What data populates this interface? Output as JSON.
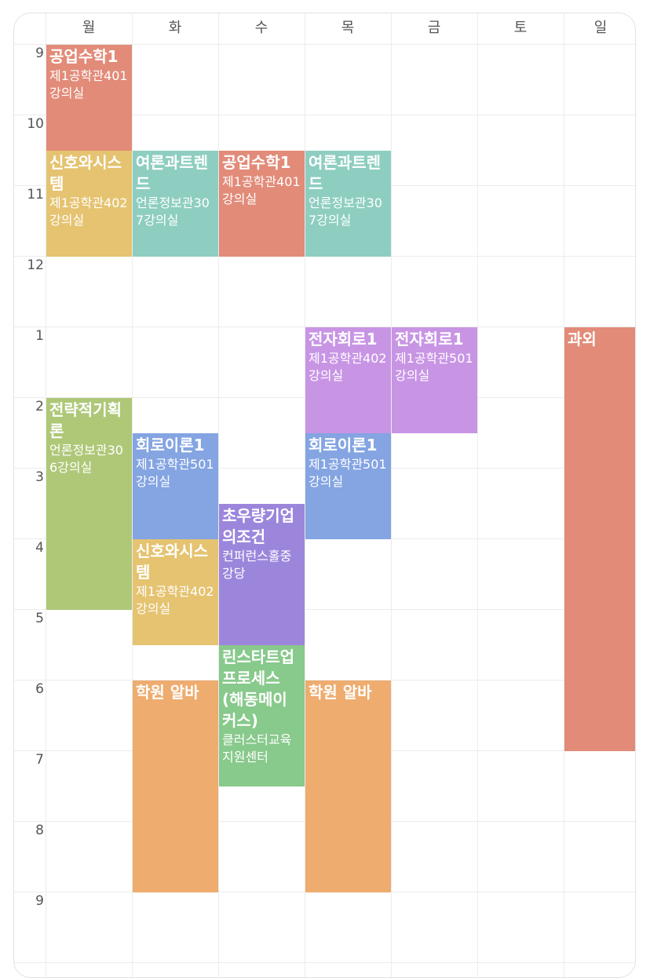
{
  "days": [
    "월",
    "화",
    "수",
    "목",
    "금",
    "토",
    "일"
  ],
  "hours": [
    "9",
    "10",
    "11",
    "12",
    "1",
    "2",
    "3",
    "4",
    "5",
    "6",
    "7",
    "8",
    "9"
  ],
  "colors": {
    "red": "#e28b79",
    "yellow": "#e5c370",
    "teal": "#8ecec0",
    "purple": "#c895e5",
    "lavender": "#9c86dc",
    "green": "#aec878",
    "blue": "#84a4e2",
    "mint": "#88c98c",
    "orange": "#eeac6f"
  },
  "courses": [
    {
      "title": "공업수학1",
      "room": "제1공학관401강의실",
      "day": 0,
      "start": 9,
      "end": 10.5,
      "color": "red"
    },
    {
      "title": "신호와시스템",
      "room": "제1공학관402강의실",
      "day": 0,
      "start": 10.5,
      "end": 12,
      "color": "yellow"
    },
    {
      "title": "여론과트렌드",
      "room": "언론정보관307강의실",
      "day": 1,
      "start": 10.5,
      "end": 12,
      "color": "teal"
    },
    {
      "title": "공업수학1",
      "room": "제1공학관401강의실",
      "day": 2,
      "start": 10.5,
      "end": 12,
      "color": "red"
    },
    {
      "title": "여론과트렌드",
      "room": "언론정보관307강의실",
      "day": 3,
      "start": 10.5,
      "end": 12,
      "color": "teal"
    },
    {
      "title": "전자회로1",
      "room": "제1공학관402강의실",
      "day": 3,
      "start": 13,
      "end": 14.5,
      "color": "purple"
    },
    {
      "title": "전자회로1",
      "room": "제1공학관501강의실",
      "day": 4,
      "start": 13,
      "end": 14.5,
      "color": "purple"
    },
    {
      "title": "과외",
      "room": "",
      "day": 6,
      "start": 13,
      "end": 19,
      "color": "red"
    },
    {
      "title": "전략적기획론",
      "room": "언론정보관306강의실",
      "day": 0,
      "start": 14,
      "end": 17,
      "color": "green"
    },
    {
      "title": "회로이론1",
      "room": "제1공학관501강의실",
      "day": 1,
      "start": 14.5,
      "end": 16,
      "color": "blue"
    },
    {
      "title": "회로이론1",
      "room": "제1공학관501강의실",
      "day": 3,
      "start": 14.5,
      "end": 16,
      "color": "blue"
    },
    {
      "title": "신호와시스템",
      "room": "제1공학관402강의실",
      "day": 1,
      "start": 16,
      "end": 17.5,
      "color": "yellow"
    },
    {
      "title": "초우량기업의조건",
      "room": "컨퍼런스홀중강당",
      "day": 2,
      "start": 15.5,
      "end": 17.5,
      "color": "lavender"
    },
    {
      "title": "린스타트업프로세스(해동메이커스)",
      "room": "클러스터교육지원센터",
      "day": 2,
      "start": 17.5,
      "end": 19.5,
      "color": "mint"
    },
    {
      "title": "학원 알바",
      "room": "",
      "day": 1,
      "start": 18,
      "end": 21,
      "color": "orange"
    },
    {
      "title": "학원 알바",
      "room": "",
      "day": 3,
      "start": 18,
      "end": 21,
      "color": "orange"
    }
  ]
}
